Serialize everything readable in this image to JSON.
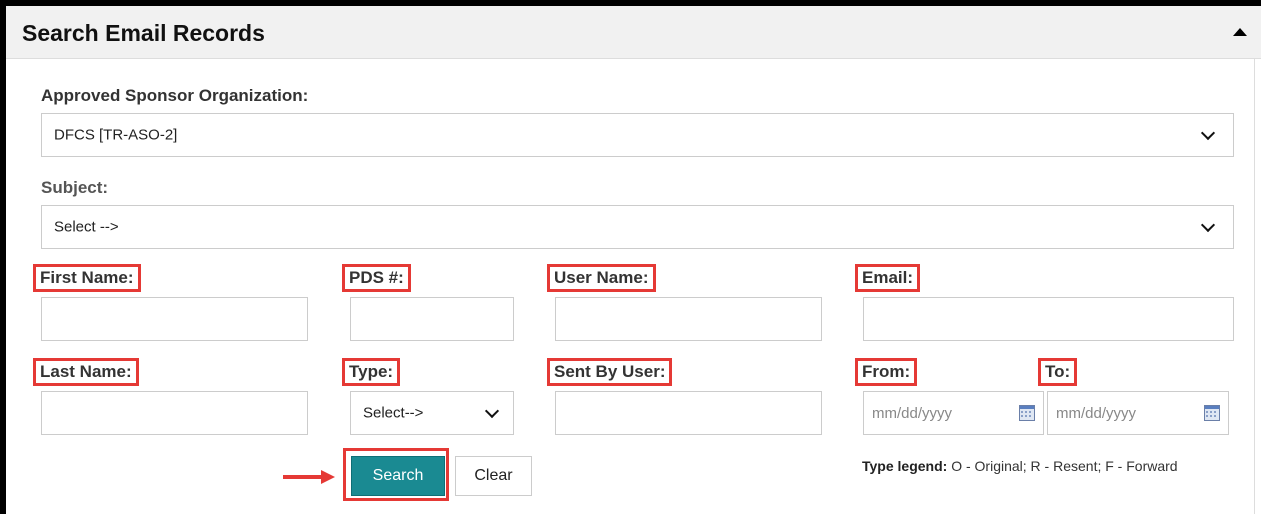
{
  "panel": {
    "title": "Search Email Records"
  },
  "aso": {
    "label": "Approved Sponsor Organization:",
    "value": "DFCS [TR-ASO-2]"
  },
  "subject": {
    "label": "Subject:",
    "value": "Select -->"
  },
  "fields": {
    "first_name": {
      "label": "First Name:",
      "value": ""
    },
    "pds": {
      "label": "PDS #:",
      "value": ""
    },
    "user_name": {
      "label": "User Name:",
      "value": ""
    },
    "email": {
      "label": "Email:",
      "value": ""
    },
    "last_name": {
      "label": "Last Name:",
      "value": ""
    },
    "type": {
      "label": "Type:",
      "value": "Select-->"
    },
    "sent_by_user": {
      "label": "Sent By User:",
      "value": ""
    },
    "from": {
      "label": "From:",
      "placeholder": "mm/dd/yyyy"
    },
    "to": {
      "label": "To:",
      "placeholder": "mm/dd/yyyy"
    }
  },
  "buttons": {
    "search": "Search",
    "clear": "Clear"
  },
  "legend": {
    "title": "Type legend:",
    "text": " O - Original; R - Resent; F - Forward"
  },
  "colors": {
    "accent": "#1a8a92",
    "highlight": "#e53935"
  },
  "icons": {
    "collapse": "caret-up-icon",
    "dropdown": "chevron-down-icon",
    "calendar": "calendar-icon",
    "pointer": "arrow-right-icon"
  }
}
